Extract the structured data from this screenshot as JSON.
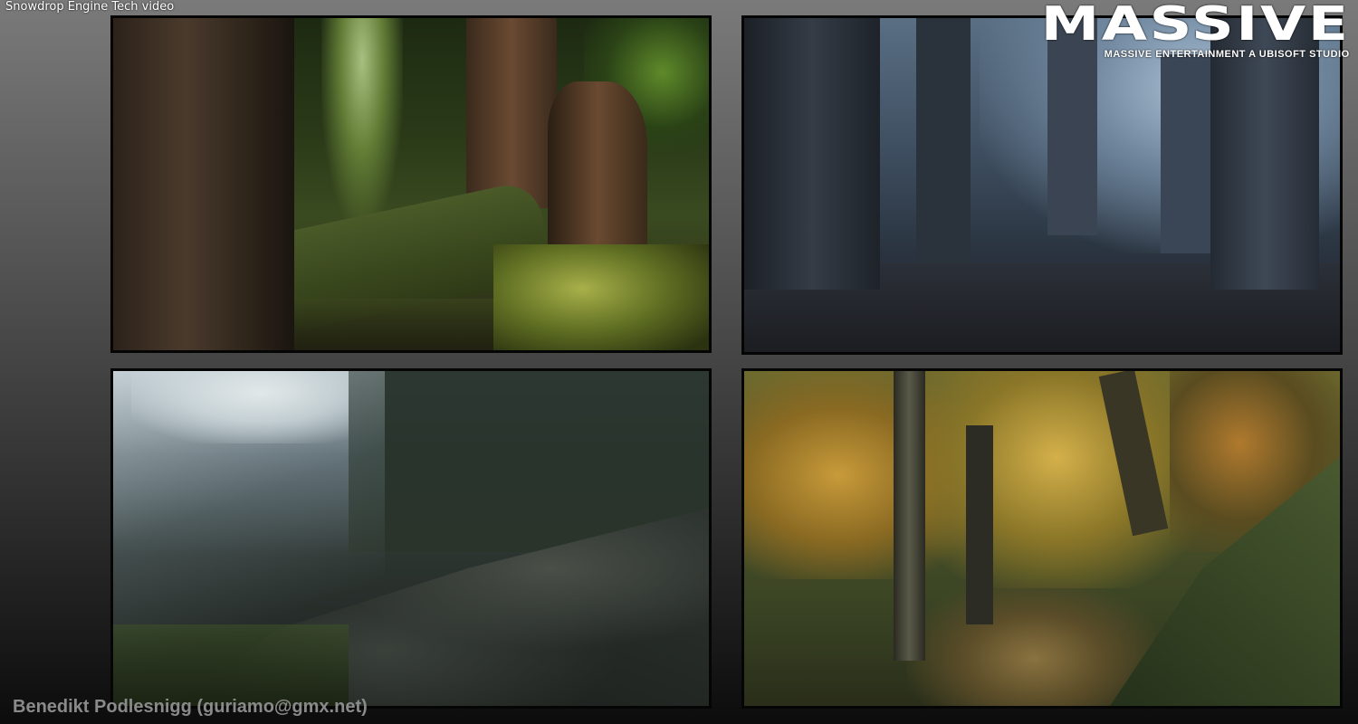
{
  "caption": "Snowdrop Engine Tech video",
  "logo": {
    "wordmark": "MASSIVE",
    "subtitle": "MASSIVE ENTERTAINMENT  A UBISOFT STUDIO"
  },
  "credit": "Benedikt Podlesnigg (guriamo@gmx.net)",
  "panels": [
    {
      "id": "p1",
      "scene": "green-forest-screenshot"
    },
    {
      "id": "p2",
      "scene": "misty-forest-screenshot"
    },
    {
      "id": "p3",
      "scene": "rocky-hillside-screenshot"
    },
    {
      "id": "p4",
      "scene": "autumn-forest-screenshot"
    }
  ]
}
